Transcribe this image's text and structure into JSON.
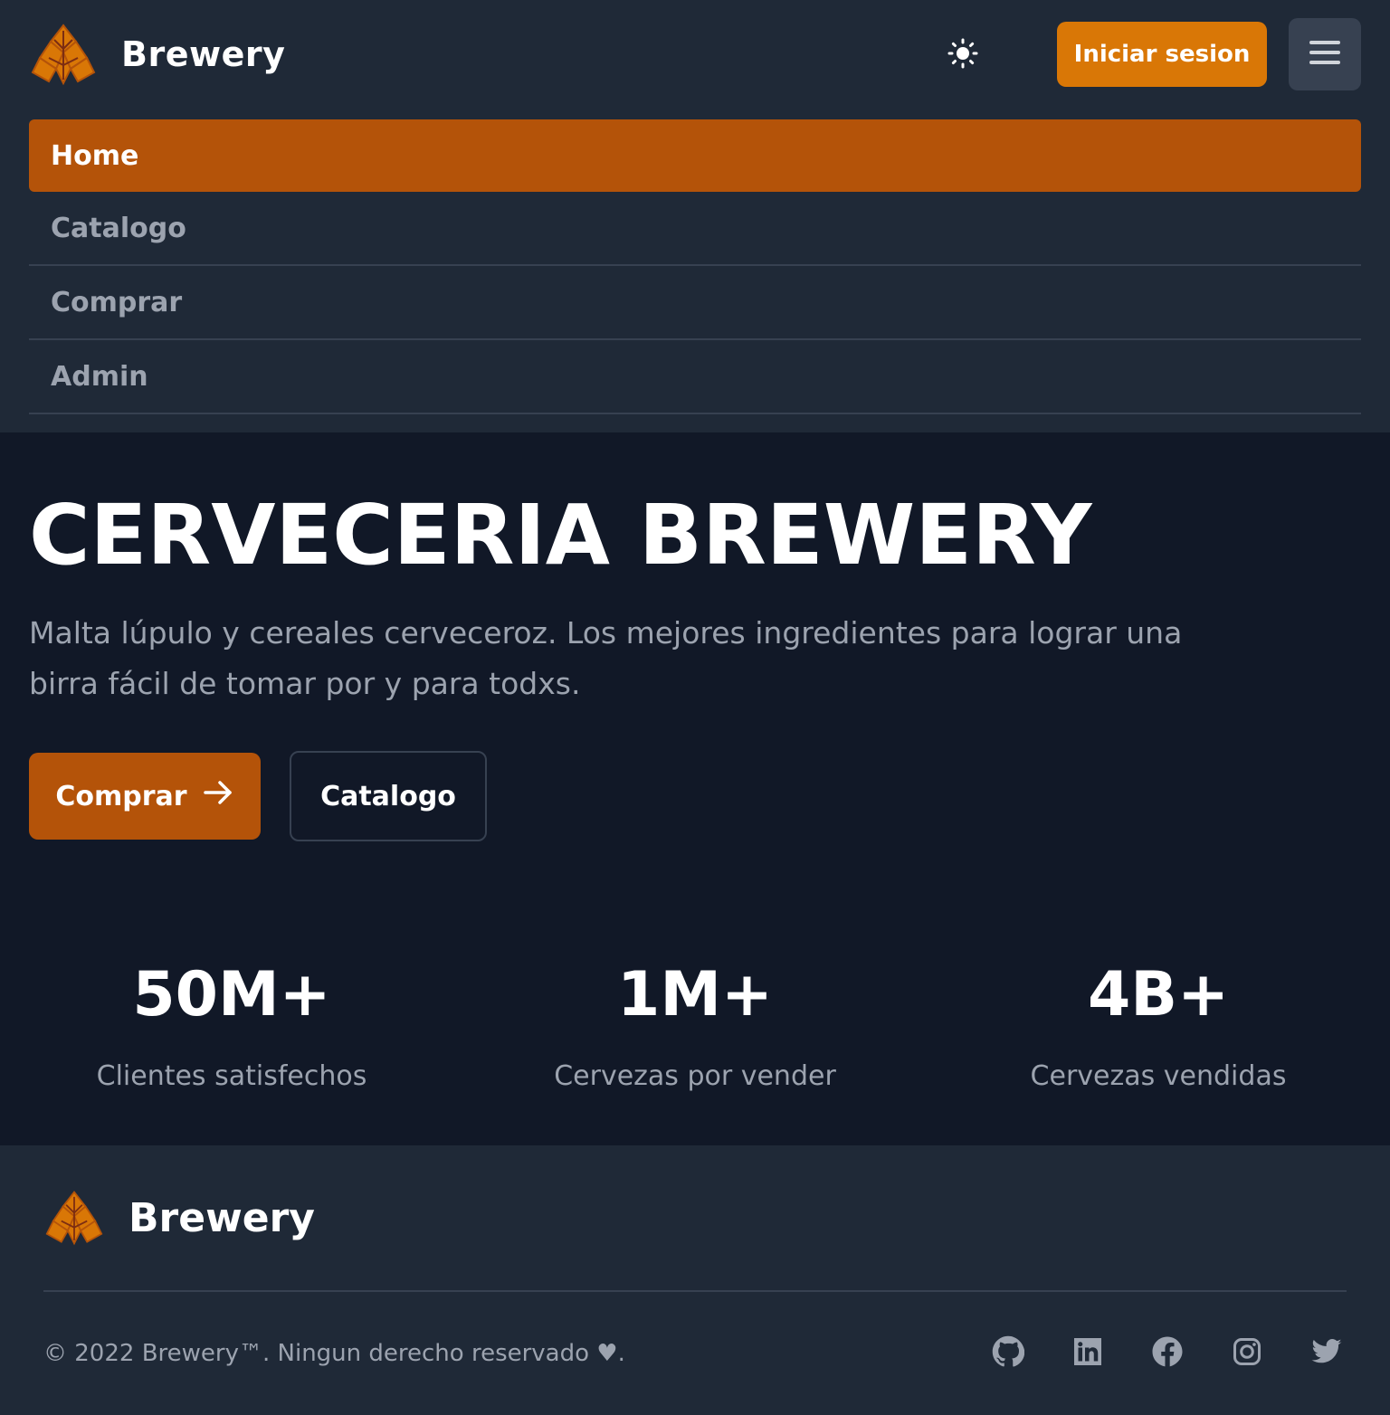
{
  "header": {
    "brand_name": "Brewery",
    "login_label": "Iniciar sesion",
    "nav": [
      {
        "label": "Home",
        "active": true
      },
      {
        "label": "Catalogo",
        "active": false
      },
      {
        "label": "Comprar",
        "active": false
      },
      {
        "label": "Admin",
        "active": false
      }
    ]
  },
  "hero": {
    "title": "CERVECERIA BREWERY",
    "description": "Malta lúpulo y cereales cerveceroz. Los mejores ingredientes para lograr una birra fácil de tomar por y para todxs.",
    "primary_label": "Comprar",
    "secondary_label": "Catalogo"
  },
  "stats": [
    {
      "value": "50M+",
      "label": "Clientes satisfechos"
    },
    {
      "value": "1M+",
      "label": "Cervezas por vender"
    },
    {
      "value": "4B+",
      "label": "Cervezas vendidas"
    }
  ],
  "footer": {
    "brand_name": "Brewery",
    "copyright": "© 2022 Brewery™. Ningun derecho reservado ♥.",
    "socials": [
      "github-icon",
      "linkedin-icon",
      "facebook-icon",
      "instagram-icon",
      "twitter-icon"
    ]
  },
  "colors": {
    "accent": "#d97706",
    "accent_dark": "#b45309",
    "header_bg": "#1f2937",
    "page_bg": "#111827",
    "muted_text": "#9ca3af"
  }
}
